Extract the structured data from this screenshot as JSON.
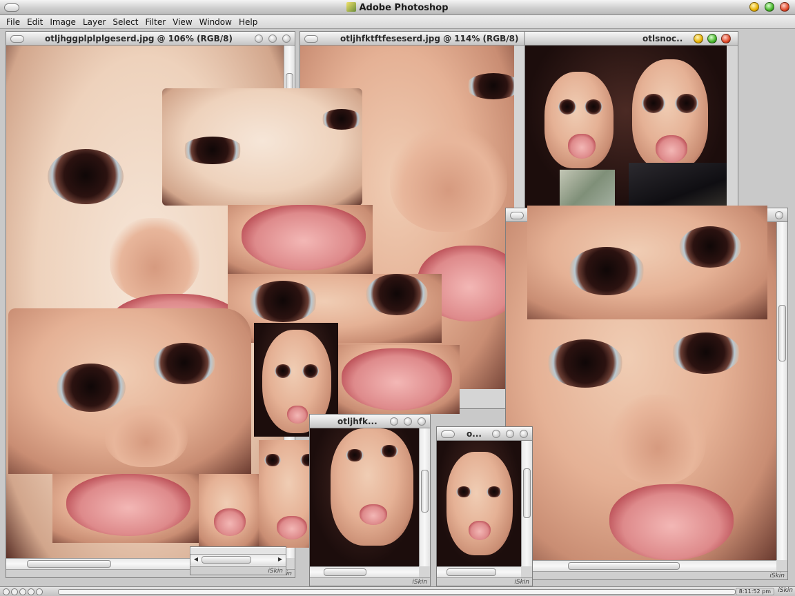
{
  "app": {
    "title": "Adobe Photoshop"
  },
  "menu": [
    "File",
    "Edit",
    "Image",
    "Layer",
    "Select",
    "Filter",
    "View",
    "Window",
    "Help"
  ],
  "windows": {
    "w1": {
      "title": "otljhggplplplgeserd.jpg @ 106% (RGB/8)"
    },
    "w2": {
      "title": "otljhfktftfeseserd.jpg @ 114% (RGB/8)"
    },
    "w3": {
      "title": "otlsnoc..."
    },
    "w4": {
      "title": "otljhfk..."
    },
    "w5": {
      "title": "o..."
    }
  },
  "skin_label": "iSkin",
  "statusbar": {
    "clock": "8:11:52 pm",
    "skin": "iSkin"
  },
  "colors": {
    "titlebar_bg": "#d9d9d9",
    "desktop_bg": "#c9c9c9",
    "traffic_close": "#e04a2a",
    "traffic_min": "#e8b200",
    "traffic_max": "#46b52a"
  }
}
